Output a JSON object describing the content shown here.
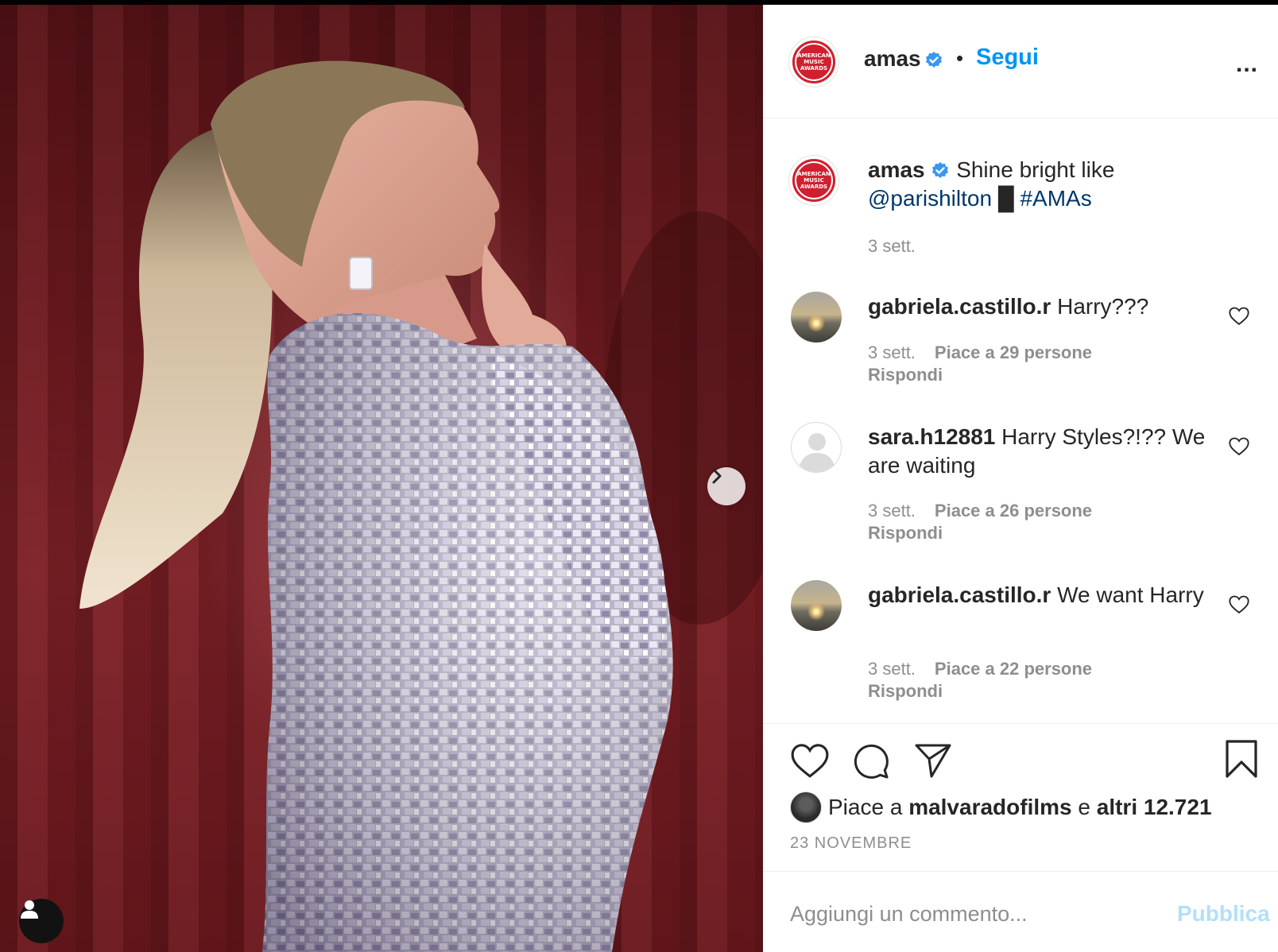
{
  "header": {
    "username": "amas",
    "separator": "•",
    "follow_label": "Segui",
    "more_label": "..."
  },
  "brand": {
    "logo_line1": "AMERICAN",
    "logo_line2": "MUSIC",
    "logo_line3": "AWARDS"
  },
  "caption": {
    "username": "amas",
    "text": "Shine bright like",
    "mention": "@parishilton",
    "emoji": "█",
    "hashtag": "#AMAs",
    "time": "3 sett."
  },
  "comments": [
    {
      "username": "gabriela.castillo.r",
      "text": "Harry???",
      "time": "3 sett.",
      "likes": "Piace a 29 persone",
      "reply": "Rispondi"
    },
    {
      "username": "sara.h12881",
      "text": "Harry Styles?!?? We are waiting",
      "time": "3 sett.",
      "likes": "Piace a 26 persone",
      "reply": "Rispondi"
    },
    {
      "username": "gabriela.castillo.r",
      "text": "We want Harry",
      "time": "3 sett.",
      "likes": "Piace a 22 persone",
      "reply": "Rispondi"
    }
  ],
  "likes": {
    "prefix": "Piace a",
    "user": "malvaradofilms",
    "joiner": "e",
    "others": "altri 12.721"
  },
  "post_date": "23 NOVEMBRE",
  "add_comment": {
    "placeholder": "Aggiungi un commento...",
    "publish_label": "Pubblica"
  },
  "colors": {
    "link_blue": "#0095f6",
    "caption_link": "#00376b",
    "meta_gray": "#8e8e8e",
    "publish_disabled": "#b2dffc",
    "verified_blue": "#3897f0",
    "brand_red": "#d0202f"
  },
  "icons": {
    "verified": "verified-badge-icon",
    "next": "chevron-right-icon",
    "user_tag": "user-tag-icon",
    "more": "ellipsis-icon",
    "like": "heart-icon",
    "comment": "comment-bubble-icon",
    "share": "paper-plane-icon",
    "save": "bookmark-icon"
  }
}
